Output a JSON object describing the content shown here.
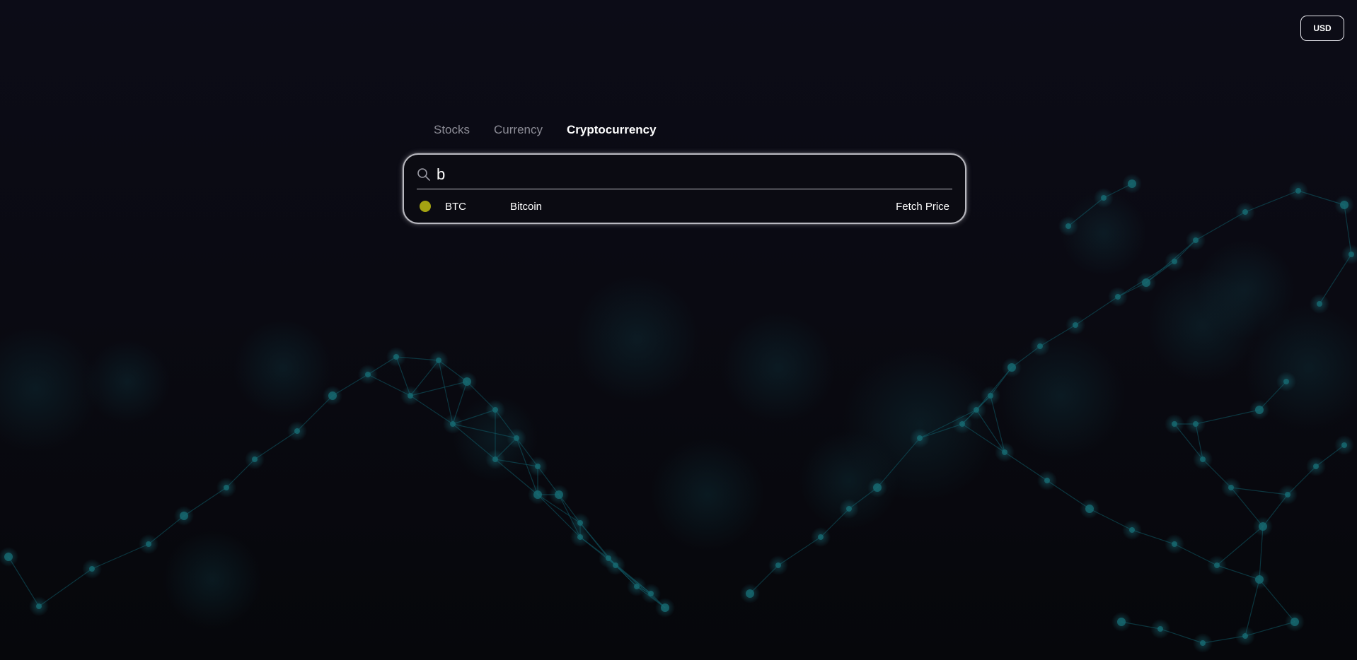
{
  "header": {
    "currency_label": "USD"
  },
  "tabs": [
    {
      "label": "Stocks",
      "active": false
    },
    {
      "label": "Currency",
      "active": false
    },
    {
      "label": "Cryptocurrency",
      "active": true
    }
  ],
  "search": {
    "value": "b",
    "placeholder": ""
  },
  "results": [
    {
      "symbol": "BTC",
      "name": "Bitcoin",
      "action_label": "Fetch Price",
      "status_color": "#a4a312"
    }
  ],
  "colors": {
    "background": "#0b0b14",
    "network_accent": "#0e4a55",
    "status_dot": "#a4a312"
  },
  "icons": {
    "search": "search-icon"
  }
}
